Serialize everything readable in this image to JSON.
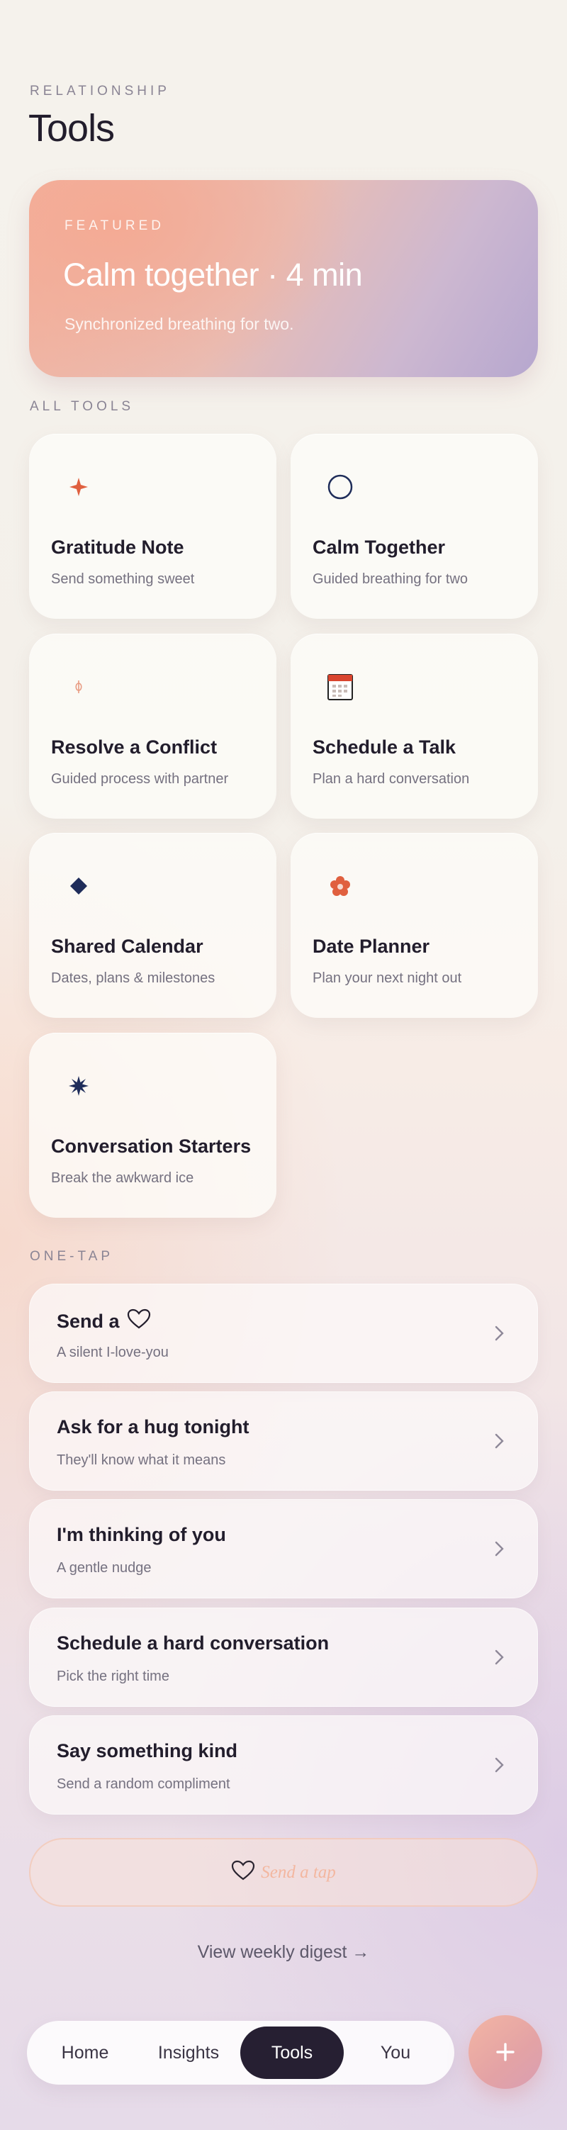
{
  "header": {
    "eyebrow": "RELATIONSHIP",
    "title": "Tools"
  },
  "featured": {
    "eyebrow": "FEATURED",
    "title": "Calm together · 4 min",
    "subtitle": "Synchronized breathing for two."
  },
  "all_tools": {
    "eyebrow": "ALL TOOLS",
    "items": [
      {
        "name": "Gratitude Note",
        "desc": "Send something sweet",
        "icon": "sparkle-icon"
      },
      {
        "name": "Calm Together",
        "desc": "Guided breathing for two",
        "icon": "circle-icon"
      },
      {
        "name": "Resolve a Conflict",
        "desc": "Guided process with partner",
        "icon": "handshake-icon"
      },
      {
        "name": "Schedule a Talk",
        "desc": "Plan a hard conversation",
        "icon": "calendar-icon"
      },
      {
        "name": "Shared Calendar",
        "desc": "Dates, plans & milestones",
        "icon": "diamond-icon"
      },
      {
        "name": "Date Planner",
        "desc": "Plan your next night out",
        "icon": "flower-icon"
      },
      {
        "name": "Conversation Starters",
        "desc": "Break the awkward ice",
        "icon": "starburst-icon"
      }
    ]
  },
  "one_tap": {
    "eyebrow": "ONE-TAP",
    "items": [
      {
        "title": "Send a",
        "subtitle": "A silent I-love-you",
        "icon": "heart-icon"
      },
      {
        "title": "Ask for a hug tonight",
        "subtitle": "They'll know what it means"
      },
      {
        "title": "I'm thinking of you",
        "subtitle": "A gentle nudge"
      },
      {
        "title": "Schedule a hard conversation",
        "subtitle": "Pick the right time"
      },
      {
        "title": "Say something kind",
        "subtitle": "Send a random compliment"
      }
    ],
    "send_tap_label": "Send a tap"
  },
  "digest_link": "View weekly digest →",
  "nav": {
    "items": [
      "Home",
      "Insights",
      "Tools",
      "You"
    ],
    "active": "Tools",
    "fab_icon": "plus-icon"
  },
  "colors": {
    "accent_coral": "#e0603f",
    "navy": "#1f2d5a",
    "nav_active": "#261f32"
  }
}
